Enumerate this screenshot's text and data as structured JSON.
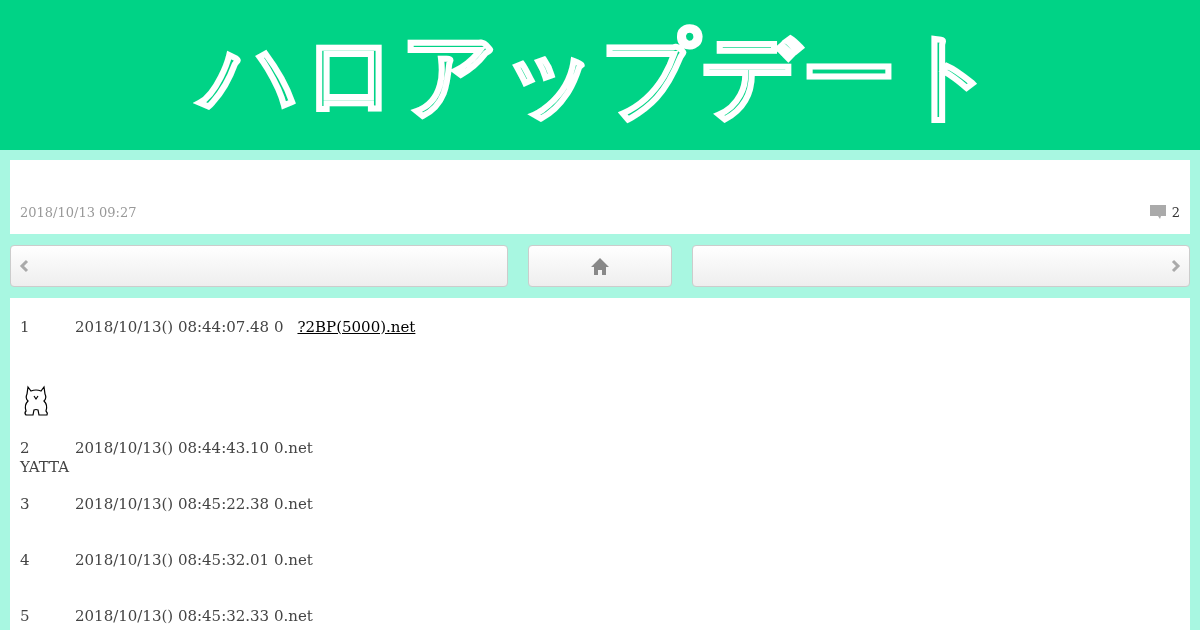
{
  "logo": "ハロアップデート",
  "article": {
    "date": "2018/10/13 09:27",
    "comments": "2"
  },
  "posts": [
    {
      "number": "1",
      "meta": "2018/10/13() 08:44:07.48 0",
      "link": "?2BP(5000).net",
      "has_art": true
    },
    {
      "number": "2",
      "meta": "2018/10/13() 08:44:43.10 0.net",
      "body": "YATTA"
    },
    {
      "number": "3",
      "meta": "2018/10/13() 08:45:22.38 0.net"
    },
    {
      "number": "4",
      "meta": "2018/10/13() 08:45:32.01 0.net"
    },
    {
      "number": "5",
      "meta": "2018/10/13() 08:45:32.33 0.net"
    }
  ]
}
